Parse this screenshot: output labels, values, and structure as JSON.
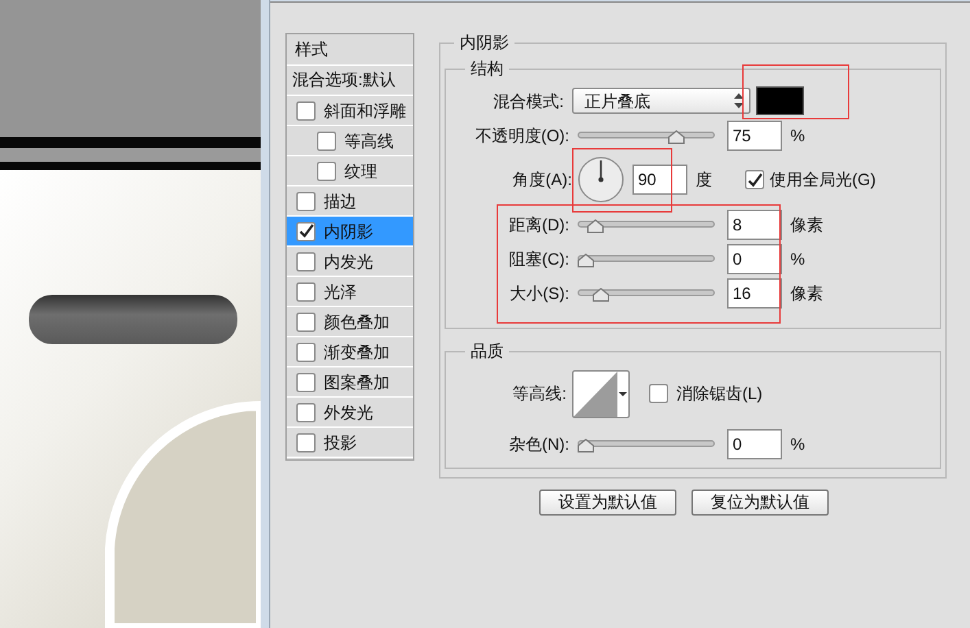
{
  "style_list": {
    "header": "样式",
    "blend_options": "混合选项:默认",
    "items": [
      {
        "label": "斜面和浮雕",
        "checked": false,
        "selected": false,
        "children": [
          {
            "label": "等高线",
            "checked": false,
            "selected": false
          },
          {
            "label": "纹理",
            "checked": false,
            "selected": false
          }
        ]
      },
      {
        "label": "描边",
        "checked": false,
        "selected": false
      },
      {
        "label": "内阴影",
        "checked": true,
        "selected": true
      },
      {
        "label": "内发光",
        "checked": false,
        "selected": false
      },
      {
        "label": "光泽",
        "checked": false,
        "selected": false
      },
      {
        "label": "颜色叠加",
        "checked": false,
        "selected": false
      },
      {
        "label": "渐变叠加",
        "checked": false,
        "selected": false
      },
      {
        "label": "图案叠加",
        "checked": false,
        "selected": false
      },
      {
        "label": "外发光",
        "checked": false,
        "selected": false
      },
      {
        "label": "投影",
        "checked": false,
        "selected": false
      }
    ]
  },
  "panel": {
    "title": "内阴影",
    "structure": {
      "title": "结构",
      "blend_mode": {
        "label": "混合模式:",
        "value": "正片叠底"
      },
      "opacity": {
        "label": "不透明度(O):",
        "value": "75",
        "unit": "%",
        "level": 0.75
      },
      "angle": {
        "label": "角度(A):",
        "value": "90",
        "unit": "度"
      },
      "global_light": {
        "label": "使用全局光(G)",
        "checked": true
      },
      "sliders": [
        {
          "label": "距离(D):",
          "value": "8",
          "unit": "像素",
          "level": 0.08
        },
        {
          "label": "阻塞(C):",
          "value": "0",
          "unit": "%",
          "level": 0
        },
        {
          "label": "大小(S):",
          "value": "16",
          "unit": "像素",
          "level": 0.12
        }
      ]
    },
    "quality": {
      "title": "品质",
      "contour_label": "等高线:",
      "anti_alias": {
        "label": "消除锯齿(L)",
        "checked": false
      },
      "noise": {
        "label": "杂色(N):",
        "value": "0",
        "unit": "%",
        "level": 0
      }
    },
    "buttons": [
      "设置为默认值",
      "复位为默认值"
    ]
  }
}
